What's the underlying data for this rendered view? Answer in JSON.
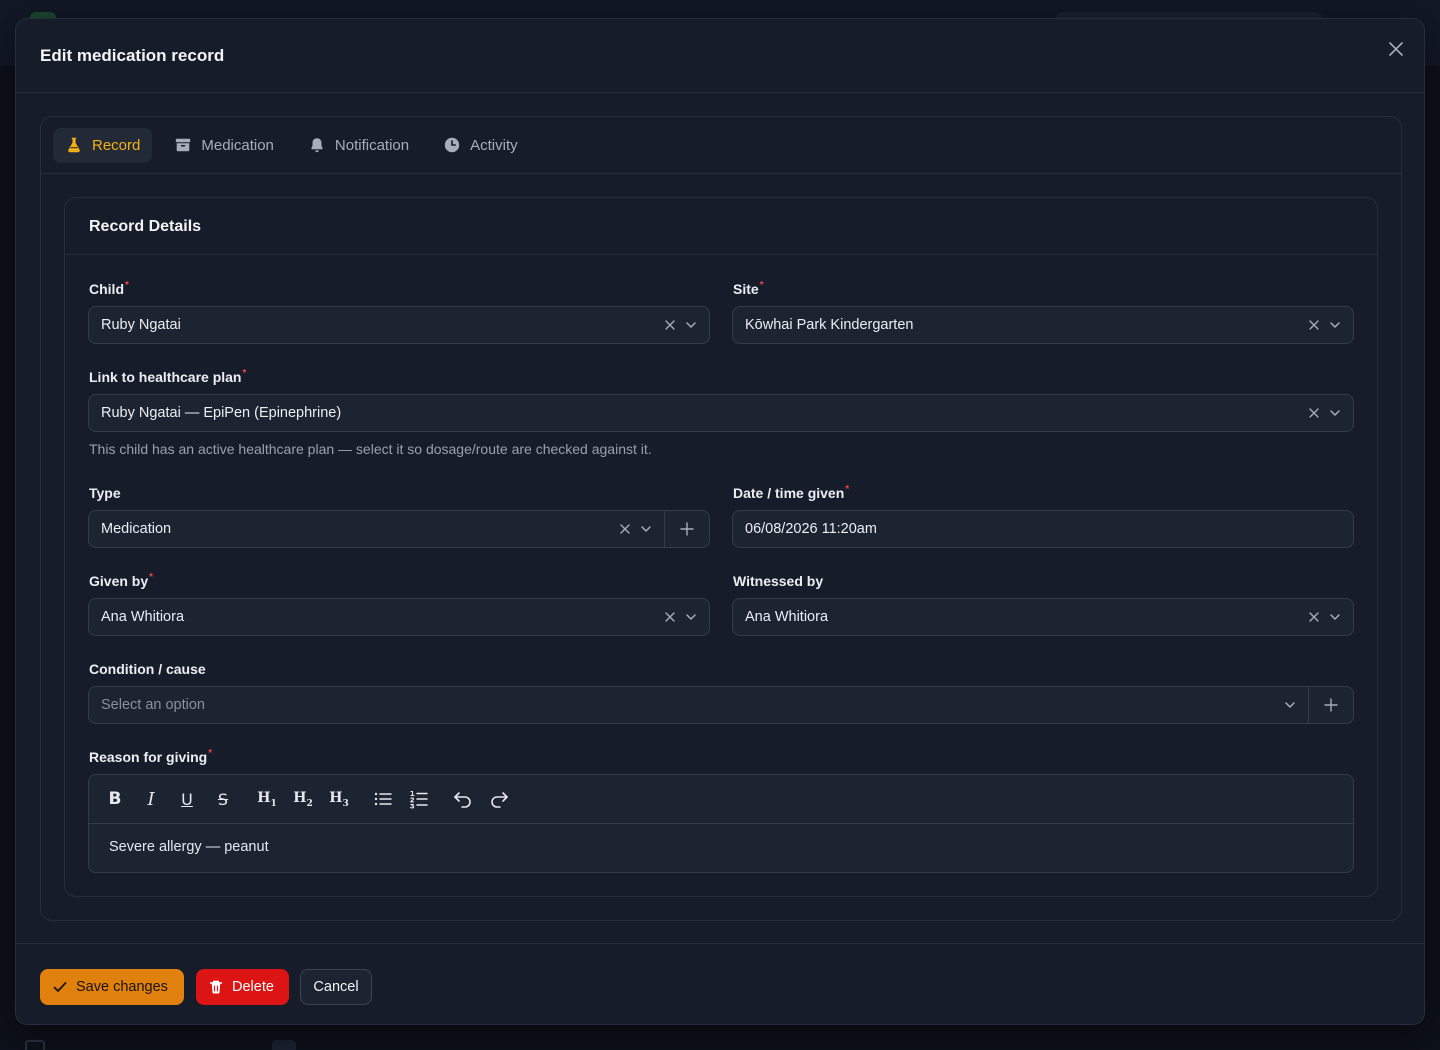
{
  "modal": {
    "title": "Edit medication record"
  },
  "tabs": [
    {
      "label": "Record",
      "icon": "flask-icon",
      "active": true
    },
    {
      "label": "Medication",
      "icon": "archive-box-icon",
      "active": false
    },
    {
      "label": "Notification",
      "icon": "bell-icon",
      "active": false
    },
    {
      "label": "Activity",
      "icon": "clock-icon",
      "active": false
    }
  ],
  "section": {
    "title": "Record Details"
  },
  "fields": {
    "child": {
      "label": "Child",
      "required": "*",
      "value": "Ruby Ngatai"
    },
    "site": {
      "label": "Site",
      "required": "*",
      "value": "Kōwhai Park Kindergarten"
    },
    "healthcare_plan": {
      "label": "Link to healthcare plan",
      "required": "*",
      "value": "Ruby Ngatai — EpiPen (Epinephrine)",
      "helper": "This child has an active healthcare plan — select it so dosage/route are checked against it."
    },
    "type": {
      "label": "Type",
      "value": "Medication"
    },
    "date_time": {
      "label": "Date / time given",
      "required": "*",
      "value": "06/08/2026 11:20am"
    },
    "given_by": {
      "label": "Given by",
      "required": "*",
      "value": "Ana Whitiora"
    },
    "witnessed_by": {
      "label": "Witnessed by",
      "value": "Ana Whitiora"
    },
    "condition": {
      "label": "Condition / cause",
      "placeholder": "Select an option"
    },
    "reason": {
      "label": "Reason for giving",
      "required": "*",
      "content": "Severe allergy — peanut"
    }
  },
  "editor_toolbar": {
    "bold": "B",
    "italic": "I",
    "underline": "U",
    "strike": "S",
    "h1": "H",
    "h1_num": "1",
    "h2": "H",
    "h2_num": "2",
    "h3": "H",
    "h3_num": "3"
  },
  "footer": {
    "save_label": "Save changes",
    "delete_label": "Delete",
    "cancel_label": "Cancel"
  },
  "colors": {
    "accent": "#f5b014",
    "save": "#e0810d",
    "delete": "#dc1414",
    "required": "#ef4444"
  }
}
